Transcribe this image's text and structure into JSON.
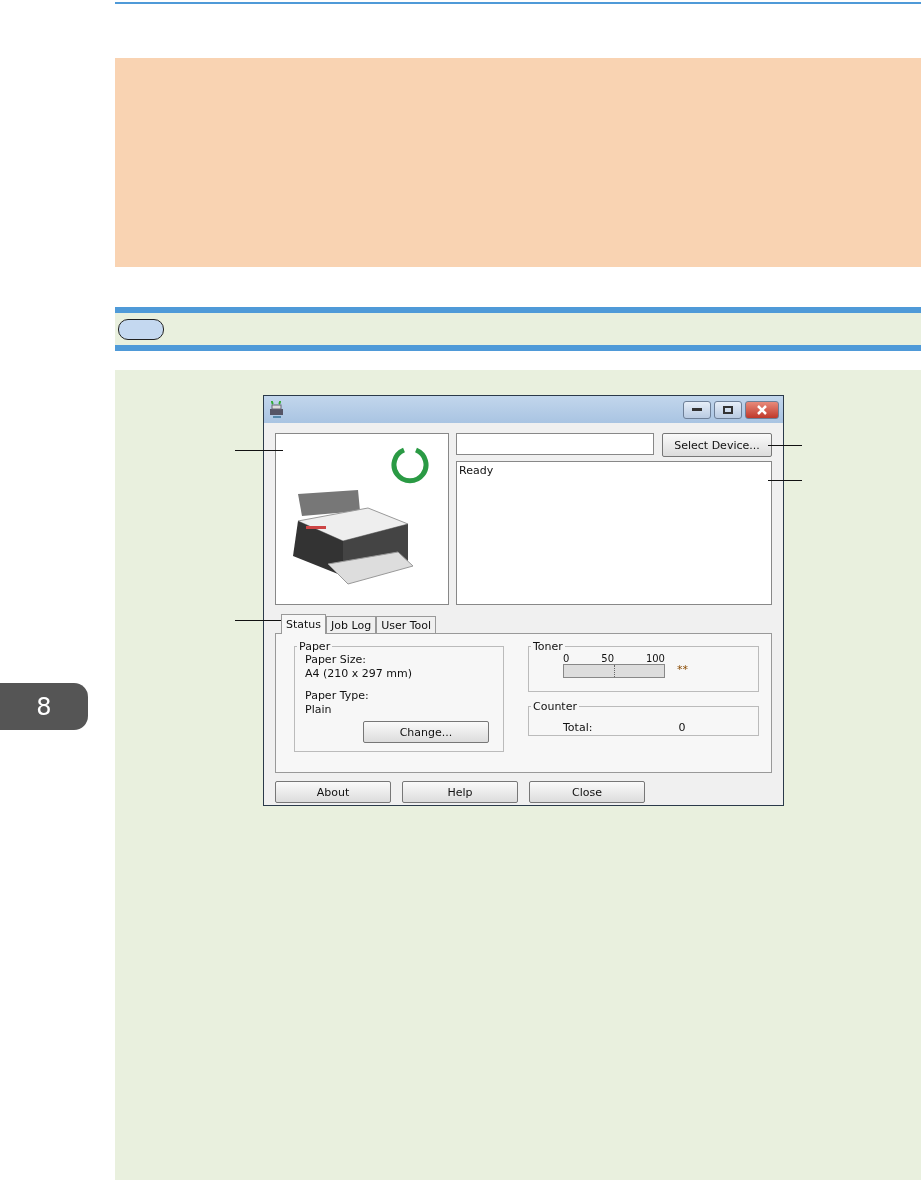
{
  "chapter_tab": "8",
  "window": {
    "select_button": "Select Device...",
    "status_text": "Ready",
    "tabs": [
      {
        "label": "Status",
        "selected": true
      },
      {
        "label": "Job Log",
        "selected": false
      },
      {
        "label": "User Tool",
        "selected": false
      }
    ],
    "paper": {
      "title": "Paper",
      "size_label": "Paper Size:",
      "size_value": "A4 (210 x 297 mm)",
      "type_label": "Paper Type:",
      "type_value": "Plain",
      "change_button": "Change..."
    },
    "toner": {
      "title": "Toner",
      "scale": [
        "0",
        "50",
        "100"
      ],
      "level": 0,
      "reading": "**"
    },
    "counter": {
      "title": "Counter",
      "label": "Total:",
      "value": "0"
    },
    "buttons": [
      "About",
      "Help",
      "Close"
    ]
  }
}
